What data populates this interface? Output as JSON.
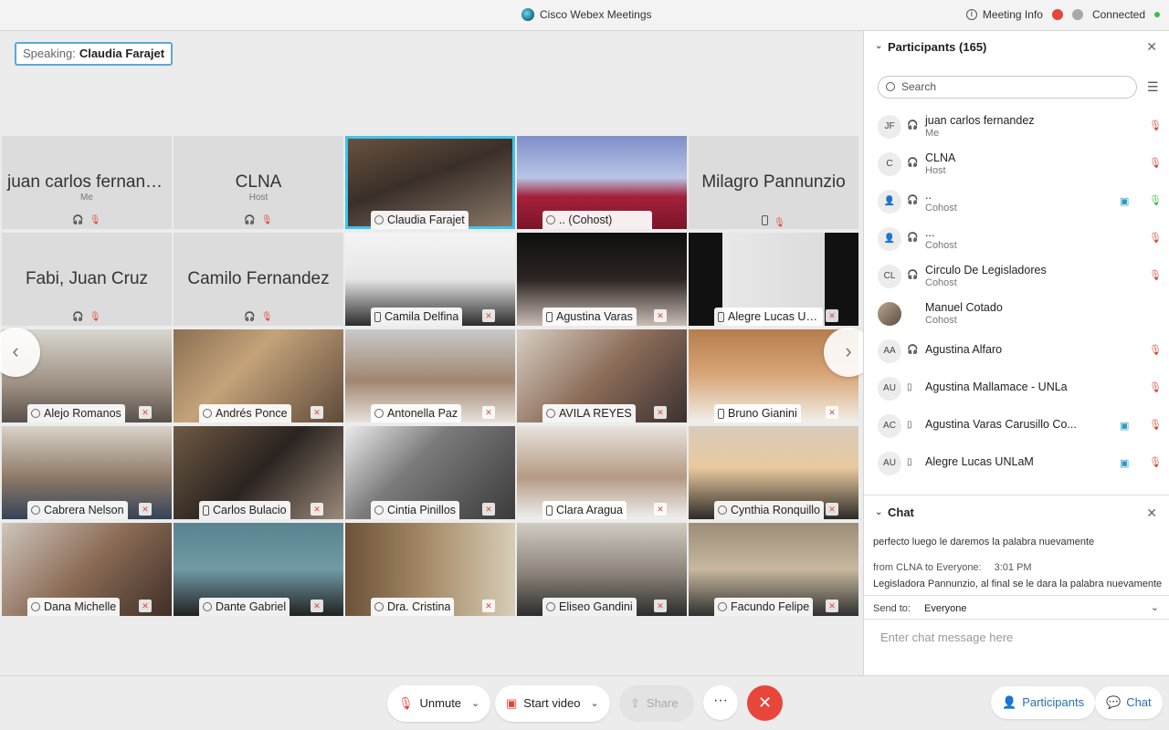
{
  "titlebar": {
    "app_title": "Cisco Webex Meetings",
    "meeting_info": "Meeting Info",
    "connection": "Connected"
  },
  "stage": {
    "speaking_label": "Speaking:",
    "speaking_name": "Claudia Farajet"
  },
  "tiles": [
    {
      "name": "juan carlos fernandez",
      "role": "Me",
      "video": false
    },
    {
      "name": "CLNA",
      "role": "Host",
      "video": false
    },
    {
      "name": "Claudia Farajet",
      "video": true,
      "active": true
    },
    {
      "name": "..  (Cohost)",
      "video": true
    },
    {
      "name": "Milagro Pannunzio",
      "video": false
    },
    {
      "name": "Fabi, Juan Cruz",
      "video": false
    },
    {
      "name": "Camilo Fernandez",
      "video": false
    },
    {
      "name": "Camila Delfina",
      "video": true
    },
    {
      "name": "Agustina Varas",
      "video": true
    },
    {
      "name": "Alegre Lucas UNLaM",
      "video": true
    },
    {
      "name": "Alejo Romanos",
      "video": true
    },
    {
      "name": "Andrés Ponce",
      "video": true
    },
    {
      "name": "Antonella Paz",
      "video": true
    },
    {
      "name": "AVILA REYES",
      "video": true
    },
    {
      "name": "Bruno Gianini",
      "video": true
    },
    {
      "name": "Cabrera Nelson",
      "video": true
    },
    {
      "name": "Carlos Bulacio",
      "video": true
    },
    {
      "name": "Cintia Pinillos",
      "video": true
    },
    {
      "name": "Clara Aragua",
      "video": true
    },
    {
      "name": "Cynthia Ronquillo",
      "video": true
    },
    {
      "name": "Dana Michelle",
      "video": true
    },
    {
      "name": "Dante Gabriel",
      "video": true
    },
    {
      "name": "Dra. Cristina",
      "video": true
    },
    {
      "name": "Eliseo Gandini",
      "video": true
    },
    {
      "name": "Facundo Felipe",
      "video": true
    }
  ],
  "toolbar": {
    "unmute": "Unmute",
    "start_video": "Start video",
    "share": "Share",
    "more": "···",
    "end": "✕",
    "participants_btn": "Participants",
    "chat_btn": "Chat"
  },
  "participants_panel": {
    "title": "Participants (165)",
    "search_placeholder": "Search",
    "items": [
      {
        "initials": "JF",
        "name": "juan carlos fernandez",
        "role": "Me"
      },
      {
        "initials": "C",
        "name": "CLNA",
        "role": "Host"
      },
      {
        "initials": "",
        "name": "..",
        "role": "Cohost"
      },
      {
        "initials": "",
        "name": "...",
        "role": "Cohost"
      },
      {
        "initials": "CL",
        "name": "Circulo De Legisladores",
        "role": "Cohost"
      },
      {
        "initials": "",
        "name": "Manuel Cotado",
        "role": "Cohost"
      },
      {
        "initials": "AA",
        "name": "Agustina Alfaro",
        "role": ""
      },
      {
        "initials": "AU",
        "name": "Agustina Mallamace - UNLa",
        "role": ""
      },
      {
        "initials": "AC",
        "name": "Agustina Varas Carusillo Co...",
        "role": ""
      },
      {
        "initials": "AU",
        "name": "Alegre Lucas UNLaM",
        "role": ""
      }
    ]
  },
  "chat_panel": {
    "title": "Chat",
    "message1": "perfecto luego le daremos la palabra nuevamente",
    "from": "from CLNA to Everyone:",
    "time": "3:01 PM",
    "message2": "Legisladora Pannunzio, al final se le dara la palabra nuevamente",
    "send_to_label": "Send to:",
    "send_to_value": "Everyone",
    "input_placeholder": "Enter chat message here"
  },
  "colors": {
    "accent": "#3ec4f0",
    "end_call": "#e8463a",
    "mute_red": "#d94a3a",
    "link_blue": "#2a6fb4"
  }
}
